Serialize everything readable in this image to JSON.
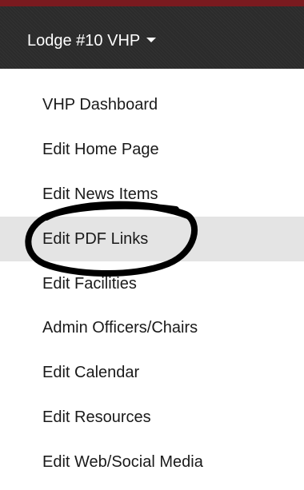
{
  "nav": {
    "dropdown_label": "Lodge #10 VHP",
    "dropdown_icon": "caret-down-icon"
  },
  "menu": {
    "items": [
      {
        "label": "VHP Dashboard"
      },
      {
        "label": "Edit Home Page"
      },
      {
        "label": "Edit News Items"
      },
      {
        "label": "Edit PDF Links"
      },
      {
        "label": "Edit Facilities"
      },
      {
        "label": "Admin Officers/Chairs"
      },
      {
        "label": "Edit Calendar"
      },
      {
        "label": "Edit Resources"
      },
      {
        "label": "Edit Web/Social Media"
      }
    ],
    "active_index": 3
  },
  "colors": {
    "accent": "#7a1a1f",
    "nav_background": "#2b2b2b",
    "active_background": "#e4e4e4",
    "annotation": "#000000"
  }
}
